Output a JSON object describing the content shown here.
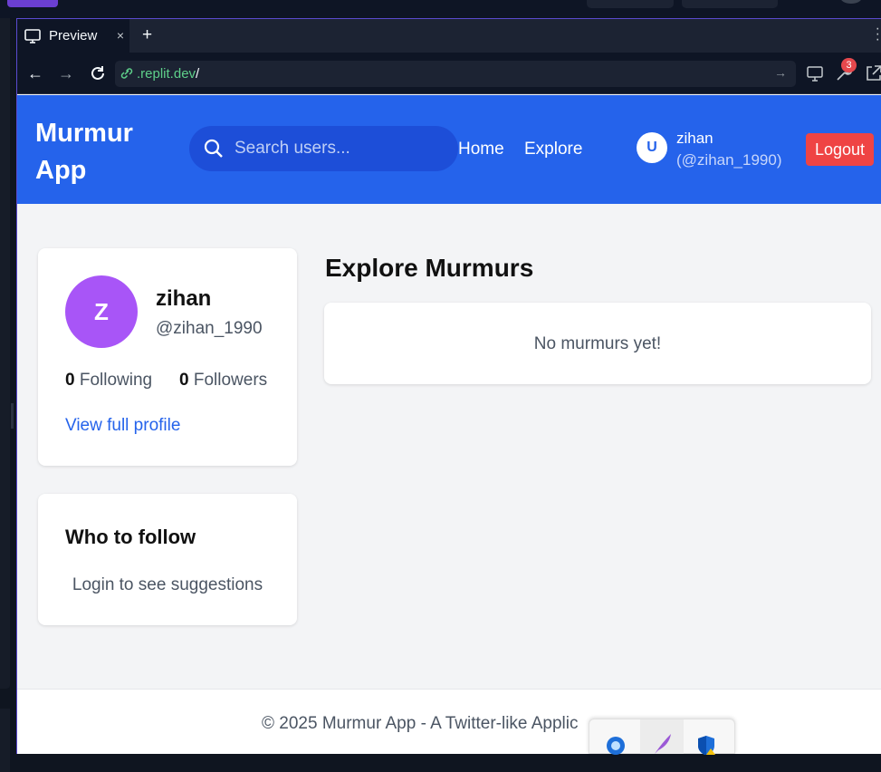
{
  "browser": {
    "tab_title": "Preview",
    "tab_close": "×",
    "new_tab": "+",
    "url_host": ".replit.dev",
    "url_path": "/",
    "badge_count": "3"
  },
  "app": {
    "brand": "Murmur App",
    "search_placeholder": "Search users...",
    "nav_home": "Home",
    "nav_explore": "Explore",
    "user_initial": "U",
    "user_name": "zihan",
    "user_handle": "(@zihan_1990)",
    "logout": "Logout"
  },
  "profile": {
    "initial": "Z",
    "name": "zihan",
    "handle": "@zihan_1990",
    "following_count": "0",
    "following_label": "Following",
    "followers_count": "0",
    "followers_label": "Followers",
    "view_profile": "View full profile"
  },
  "who_to_follow": {
    "title": "Who to follow",
    "text": "Login to see suggestions"
  },
  "feed": {
    "title": "Explore Murmurs",
    "empty": "No murmurs yet!"
  },
  "footer": {
    "text": "© 2025 Murmur App - A Twitter-like Applic"
  },
  "colors": {
    "primary": "#2563eb",
    "logout": "#ef4444",
    "avatar": "#a855f7"
  }
}
